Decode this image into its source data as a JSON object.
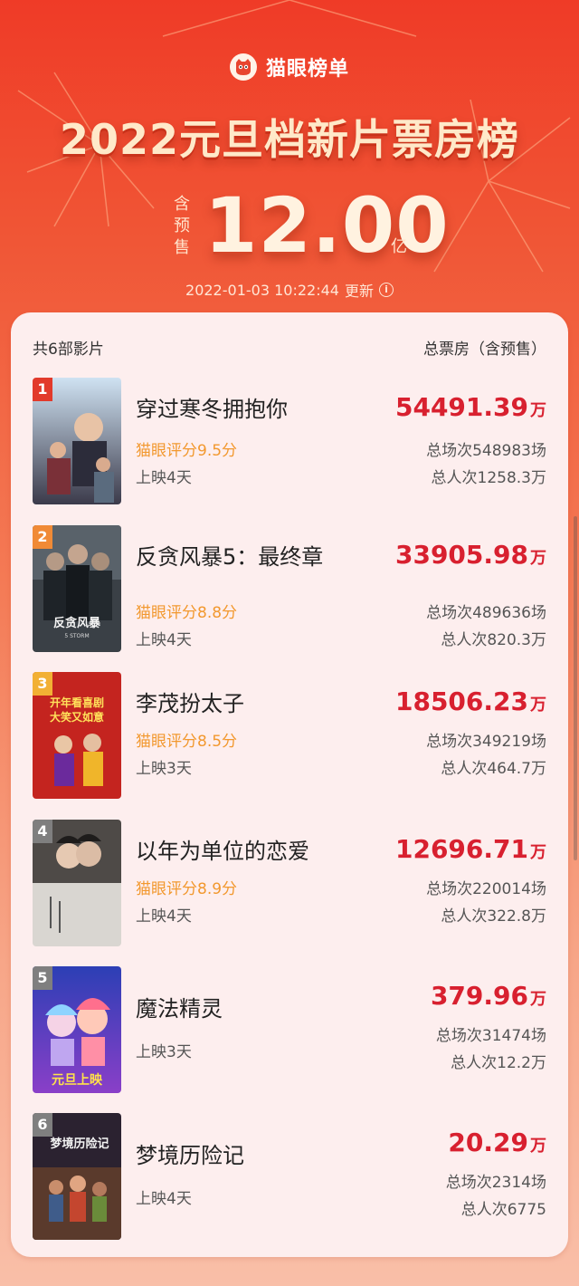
{
  "header": {
    "brand": "猫眼榜单",
    "title": "2022元旦档新片票房榜",
    "presale_note": "含预售",
    "total_value": "12.00",
    "total_unit": "亿",
    "updated_time": "2022-01-03  10:22:44",
    "updated_label": "更新",
    "info_glyph": "i"
  },
  "list": {
    "count_label": "共6部影片",
    "column_label": "总票房（含预售）",
    "wan_unit": "万",
    "movies": [
      {
        "rank": "1",
        "title": "穿过寒冬拥抱你",
        "rating": "猫眼评分9.5分",
        "days": "上映4天",
        "gross": "54491.39",
        "shows": "总场次548983场",
        "people": "总人次1258.3万",
        "badge_color": "#e23a2b"
      },
      {
        "rank": "2",
        "title": "反贪风暴5：最终章",
        "rating": "猫眼评分8.8分",
        "days": "上映4天",
        "gross": "33905.98",
        "shows": "总场次489636场",
        "people": "总人次820.3万",
        "badge_color": "#f08a36"
      },
      {
        "rank": "3",
        "title": "李茂扮太子",
        "rating": "猫眼评分8.5分",
        "days": "上映3天",
        "gross": "18506.23",
        "shows": "总场次349219场",
        "people": "总人次464.7万",
        "badge_color": "#f2b034"
      },
      {
        "rank": "4",
        "title": "以年为单位的恋爱",
        "rating": "猫眼评分8.9分",
        "days": "上映4天",
        "gross": "12696.71",
        "shows": "总场次220014场",
        "people": "总人次322.8万",
        "badge_color": "#7f7f7f"
      },
      {
        "rank": "5",
        "title": "魔法精灵",
        "rating": "",
        "days": "上映3天",
        "gross": "379.96",
        "shows": "总场次31474场",
        "people": "总人次12.2万",
        "badge_color": "#7f7f7f"
      },
      {
        "rank": "6",
        "title": "梦境历险记",
        "rating": "",
        "days": "上映4天",
        "gross": "20.29",
        "shows": "总场次2314场",
        "people": "总人次6775",
        "badge_color": "#7f7f7f"
      }
    ]
  },
  "posters": [
    {
      "text": "",
      "text2": ""
    },
    {
      "text": "反贪风暴",
      "text2": "5 STORM"
    },
    {
      "text": "开年看喜剧",
      "text2": "大笑又如意"
    },
    {
      "text": "",
      "text2": ""
    },
    {
      "text": "元旦上映",
      "text2": ""
    },
    {
      "text": "梦境历险记",
      "text2": ""
    }
  ],
  "colors": {
    "accent_red": "#d8202f",
    "rating_orange": "#f2982e",
    "header_red": "#ef3b27"
  }
}
